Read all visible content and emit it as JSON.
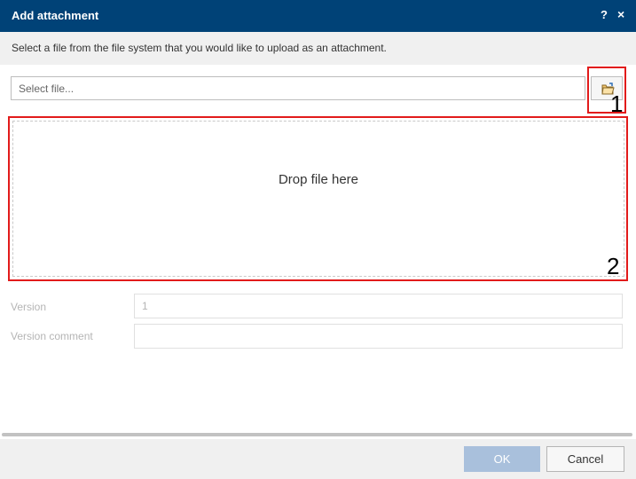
{
  "dialog": {
    "title": "Add attachment",
    "help_label": "?",
    "close_label": "×",
    "instruction": "Select a file from the file system that you would like to upload as an attachment."
  },
  "file_select": {
    "placeholder": "Select file...",
    "value": "",
    "browse_icon": "folder-open-icon"
  },
  "dropzone": {
    "label": "Drop file here"
  },
  "form": {
    "version_label": "Version",
    "version_value": "1",
    "comment_label": "Version comment",
    "comment_value": ""
  },
  "footer": {
    "ok_label": "OK",
    "cancel_label": "Cancel"
  },
  "annotations": {
    "marker1": "1",
    "marker2": "2",
    "color": "#e21b1b"
  },
  "colors": {
    "titlebar": "#004277",
    "ok_disabled": "#a9c0dc"
  }
}
